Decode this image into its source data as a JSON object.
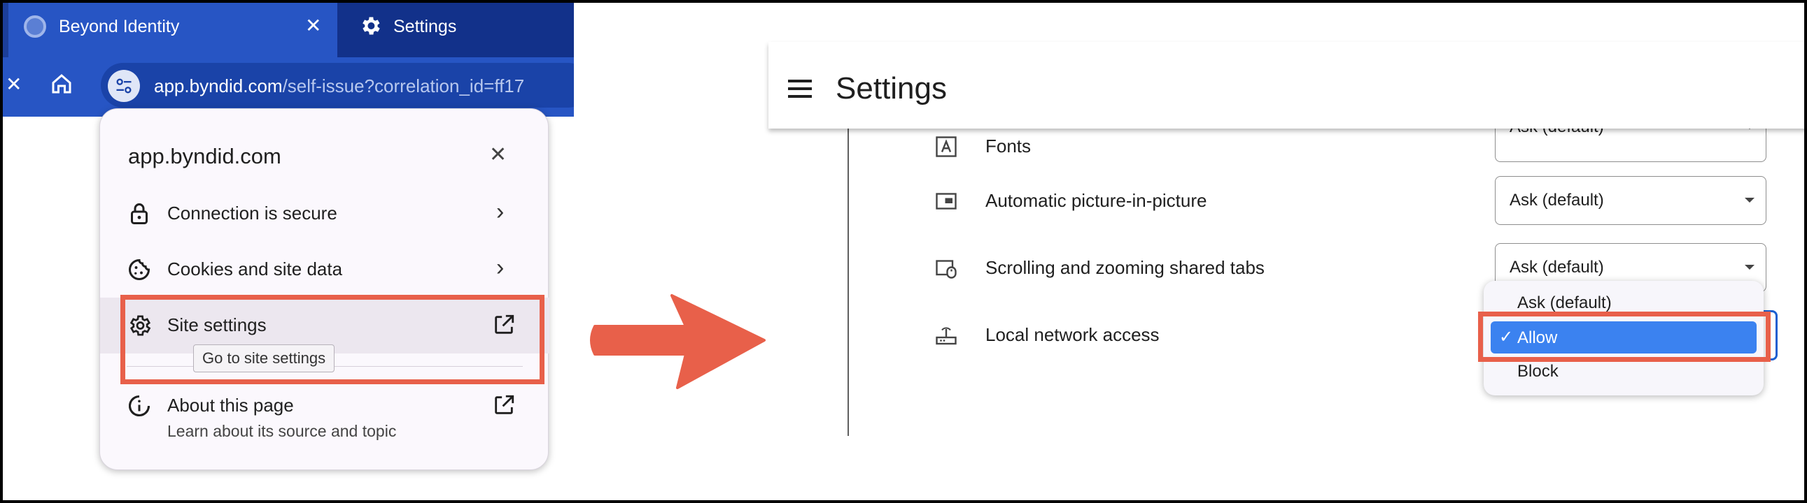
{
  "browser": {
    "active_tab_title": "Beyond Identity",
    "inactive_tab_title": "Settings",
    "url_domain": "app.byndid.com",
    "url_path": "/self-issue?correlation_id=ff17"
  },
  "site_popup": {
    "title": "app.byndid.com",
    "items": [
      {
        "label": "Connection is secure",
        "icon": "lock-icon"
      },
      {
        "label": "Cookies and site data",
        "icon": "cookie-icon"
      },
      {
        "label": "Site settings",
        "icon": "gear-icon"
      },
      {
        "label": "About this page",
        "icon": "info-icon"
      }
    ],
    "tooltip": "Go to site settings",
    "about_subtitle": "Learn about its source and topic"
  },
  "settings_page": {
    "title": "Settings",
    "rows": [
      {
        "label": "Fonts",
        "value": "Ask (default)",
        "icon": "fonts-icon"
      },
      {
        "label": "Automatic picture-in-picture",
        "value": "Ask (default)",
        "icon": "pip-icon"
      },
      {
        "label": "Scrolling and zooming shared tabs",
        "value": "Ask (default)",
        "icon": "scroll-zoom-icon"
      },
      {
        "label": "Local network access",
        "icon": "router-icon"
      }
    ],
    "dropdown_options": [
      "Ask (default)",
      "Allow",
      "Block"
    ],
    "dropdown_selected": "Allow"
  },
  "colors": {
    "highlight_box": "#e8604a",
    "chrome_blue": "#2755c4",
    "selected_option": "#3b82f0"
  }
}
